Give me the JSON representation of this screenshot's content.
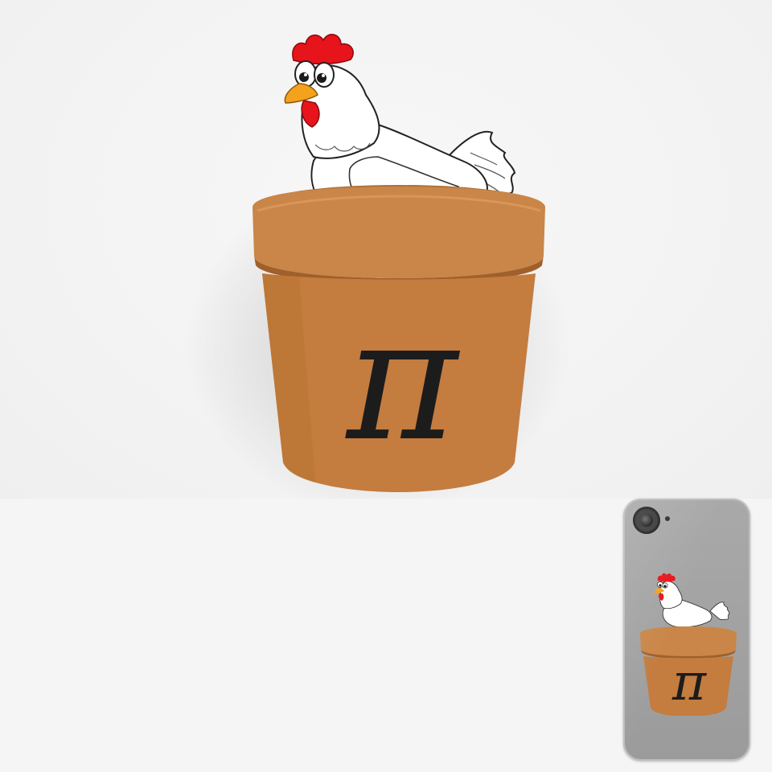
{
  "artwork": {
    "symbol": "π",
    "pot_color": "#c47c3f",
    "pot_rim_color": "#c98648",
    "pot_dark_color": "#a0602b",
    "chicken_body_color": "#ffffff",
    "comb_color": "#e8141b",
    "beak_color": "#f4a21c",
    "symbol_color": "#1c1c1c"
  },
  "phone_case": {
    "color": "#9f9f9f",
    "camera_icon": "camera-icon"
  }
}
